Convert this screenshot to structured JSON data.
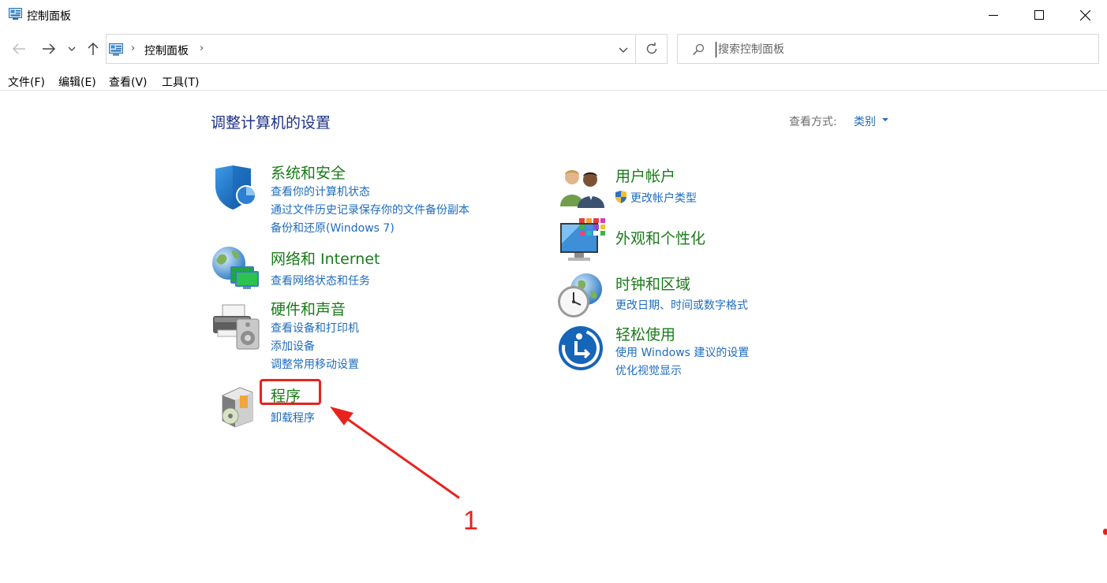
{
  "window": {
    "title": "控制面板"
  },
  "nav": {
    "address_text": "控制面板",
    "search_placeholder": "搜索控制面板"
  },
  "menu": [
    "文件(F)",
    "编辑(E)",
    "查看(V)",
    "工具(T)"
  ],
  "content": {
    "page_title": "调整计算机的设置",
    "view_by_label": "查看方式:",
    "view_by_value": "类别"
  },
  "categories": {
    "system_security": {
      "title": "系统和安全",
      "links": [
        "查看你的计算机状态",
        "通过文件历史记录保存你的文件备份副本",
        "备份和还原(Windows 7)"
      ]
    },
    "network": {
      "title": "网络和 Internet",
      "links": [
        "查看网络状态和任务"
      ]
    },
    "hardware": {
      "title": "硬件和声音",
      "links": [
        "查看设备和打印机",
        "添加设备",
        "调整常用移动设置"
      ]
    },
    "programs": {
      "title": "程序",
      "links": [
        "卸载程序"
      ]
    },
    "user_accounts": {
      "title": "用户帐户",
      "links": [
        "更改帐户类型"
      ]
    },
    "appearance": {
      "title": "外观和个性化",
      "links": []
    },
    "clock_region": {
      "title": "时钟和区域",
      "links": [
        "更改日期、时间或数字格式"
      ]
    },
    "ease_access": {
      "title": "轻松使用",
      "links": [
        "使用 Windows 建议的设置",
        "优化视觉显示"
      ]
    }
  },
  "annotation": {
    "number": "1"
  },
  "colors": {
    "title_blue": "#1e3287",
    "category_green": "#1a7b1a",
    "link_blue": "#1e6cbf",
    "annotation_red": "#e8231e"
  }
}
